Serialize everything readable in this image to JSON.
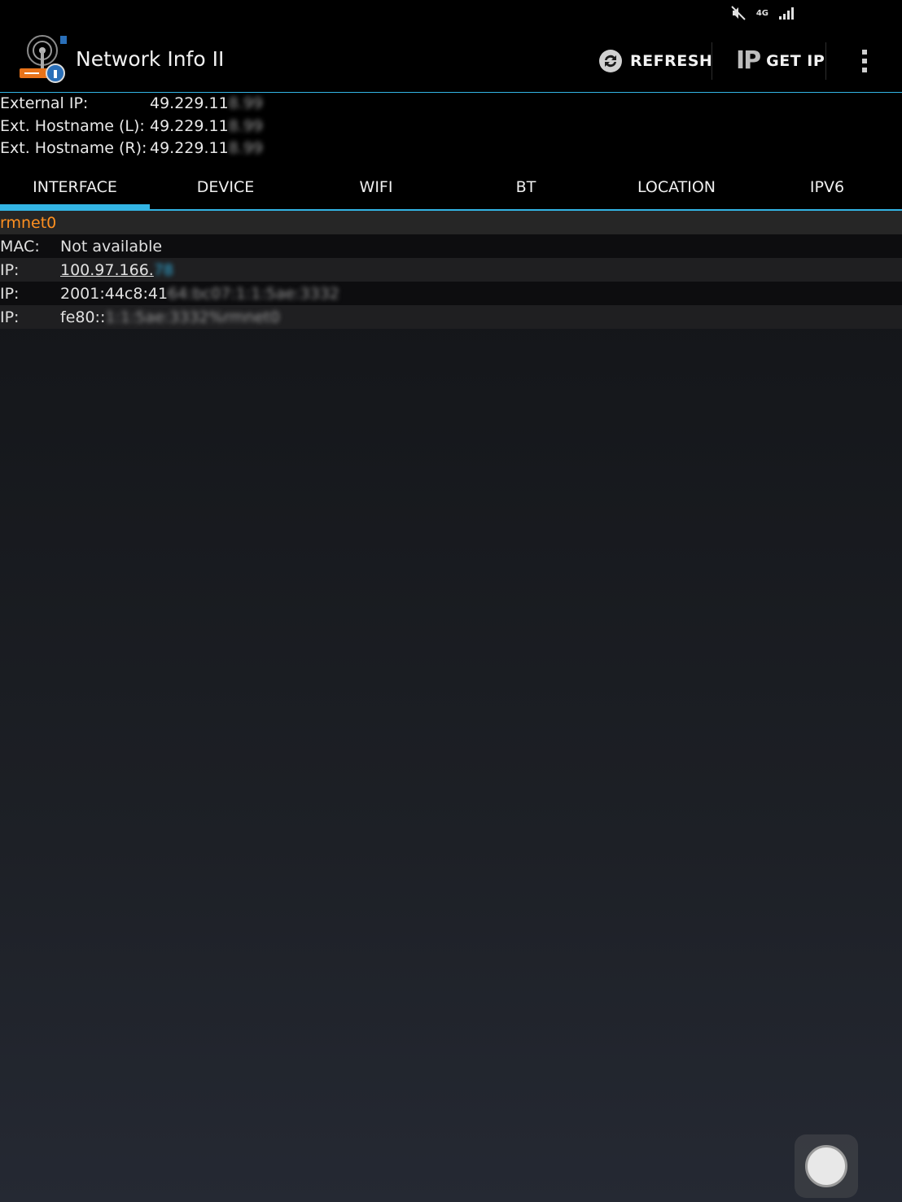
{
  "statusbar": {
    "network_label": "4G"
  },
  "app": {
    "title": "Network Info II"
  },
  "actions": {
    "refresh_label": "REFRESH",
    "getip_label": "GET IP",
    "ip_glyph": "IP"
  },
  "external": [
    {
      "label": "External IP:",
      "value": "49.229.11",
      "value_hidden": "8.99"
    },
    {
      "label": "Ext. Hostname (L):",
      "value": "49.229.11",
      "value_hidden": "8.99"
    },
    {
      "label": "Ext. Hostname (R):",
      "value": "49.229.11",
      "value_hidden": "8.99"
    }
  ],
  "tabs": [
    "INTERFACE",
    "DEVICE",
    "WIFI",
    "BT",
    "LOCATION",
    "IPV6"
  ],
  "active_tab": "INTERFACE",
  "interface": {
    "name": "rmnet0",
    "rows": [
      {
        "label": "MAC:",
        "value": "Not available",
        "hidden": ""
      },
      {
        "label": "IP:",
        "value": "100.97.166.",
        "hidden": "78"
      },
      {
        "label": "IP:",
        "value": "2001:44c8:41",
        "hidden": "64:bc07:1:1:5ae:3332"
      },
      {
        "label": "IP:",
        "value": "fe80::",
        "hidden": "1:1:5ae:3332%rmnet0"
      }
    ]
  },
  "colors": {
    "accent": "#33b5e5",
    "interface_name": "#ff9020",
    "link": "#33b5e5"
  }
}
